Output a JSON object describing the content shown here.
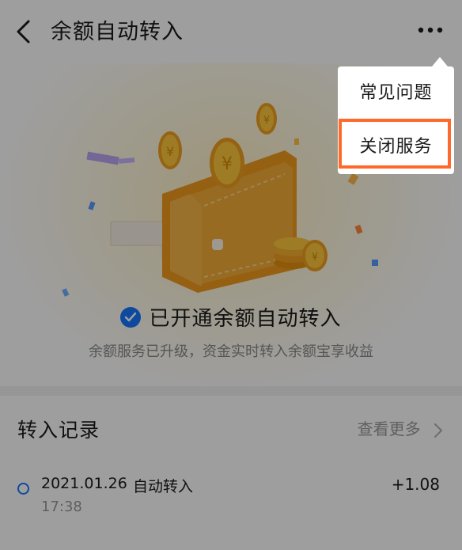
{
  "header": {
    "back_icon": "chevron-left-icon",
    "title": "余额自动转入",
    "more_icon": "more-dots-icon"
  },
  "status": {
    "check_icon": "check-circle-icon",
    "title": "已开通余额自动转入",
    "subtitle": "余额服务已升级，资金实时转入余额宝享收益"
  },
  "records": {
    "title": "转入记录",
    "see_more": "查看更多",
    "items": [
      {
        "date": "2021.01.26",
        "type": "自动转入",
        "time": "17:38",
        "amount": "+1.08"
      }
    ]
  },
  "popup_menu": {
    "items": [
      {
        "label": "常见问题"
      },
      {
        "label": "关闭服务",
        "highlighted": true
      }
    ]
  },
  "colors": {
    "accent_blue": "#1677ff",
    "highlight_orange": "#ff6a2b",
    "wallet_orange": "#f5a21a"
  }
}
